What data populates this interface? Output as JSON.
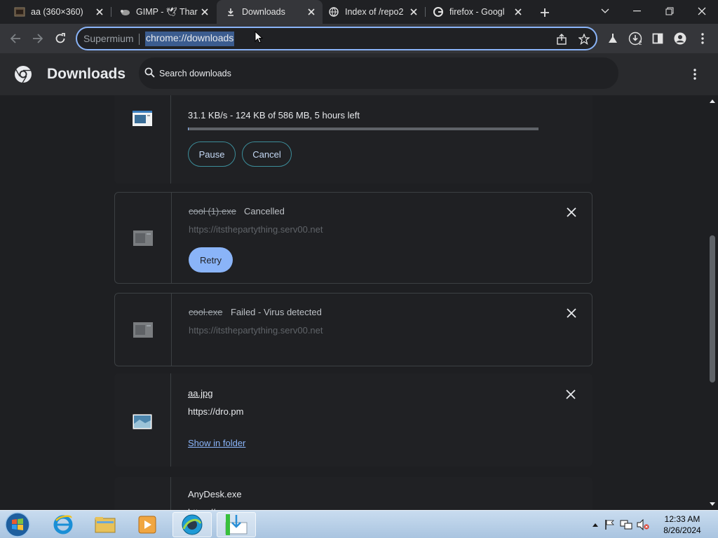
{
  "tabs": [
    {
      "title": "aa (360×360)",
      "favicon": "image-thumbnail-icon",
      "active": false
    },
    {
      "title": "GIMP - 🕊 Thar",
      "favicon": "gimp-icon",
      "active": false
    },
    {
      "title": "Downloads",
      "favicon": "download-icon",
      "active": true
    },
    {
      "title": "Index of /repo2",
      "favicon": "globe-icon",
      "active": false
    },
    {
      "title": "firefox - Googl",
      "favicon": "google-icon",
      "active": false
    }
  ],
  "omnibox": {
    "site": "Supermium",
    "url": "chrome://downloads"
  },
  "toolbar": {
    "downloads_badge": "2"
  },
  "header": {
    "title": "Downloads",
    "search_placeholder": "Search downloads"
  },
  "downloads": [
    {
      "progress_text": "31.1 KB/s - 124 KB of 586 MB, 5 hours left",
      "progress": 0.0002,
      "pause_label": "Pause",
      "cancel_label": "Cancel"
    },
    {
      "name": "cool (1).exe",
      "status": "Cancelled",
      "url": "https://itsthepartything.serv00.net",
      "action_label": "Retry"
    },
    {
      "name": "cool.exe",
      "status": "Failed - Virus detected",
      "url": "https://itsthepartything.serv00.net"
    },
    {
      "name": "aa.jpg",
      "url": "https://dro.pm",
      "action_label": "Show in folder"
    },
    {
      "name": "AnyDesk.exe"
    }
  ],
  "taskbar": {
    "time": "12:33 AM",
    "date": "8/26/2024"
  },
  "colors": {
    "accent": "#8ab4f8",
    "background": "#1e1f22",
    "card": "#202124"
  }
}
